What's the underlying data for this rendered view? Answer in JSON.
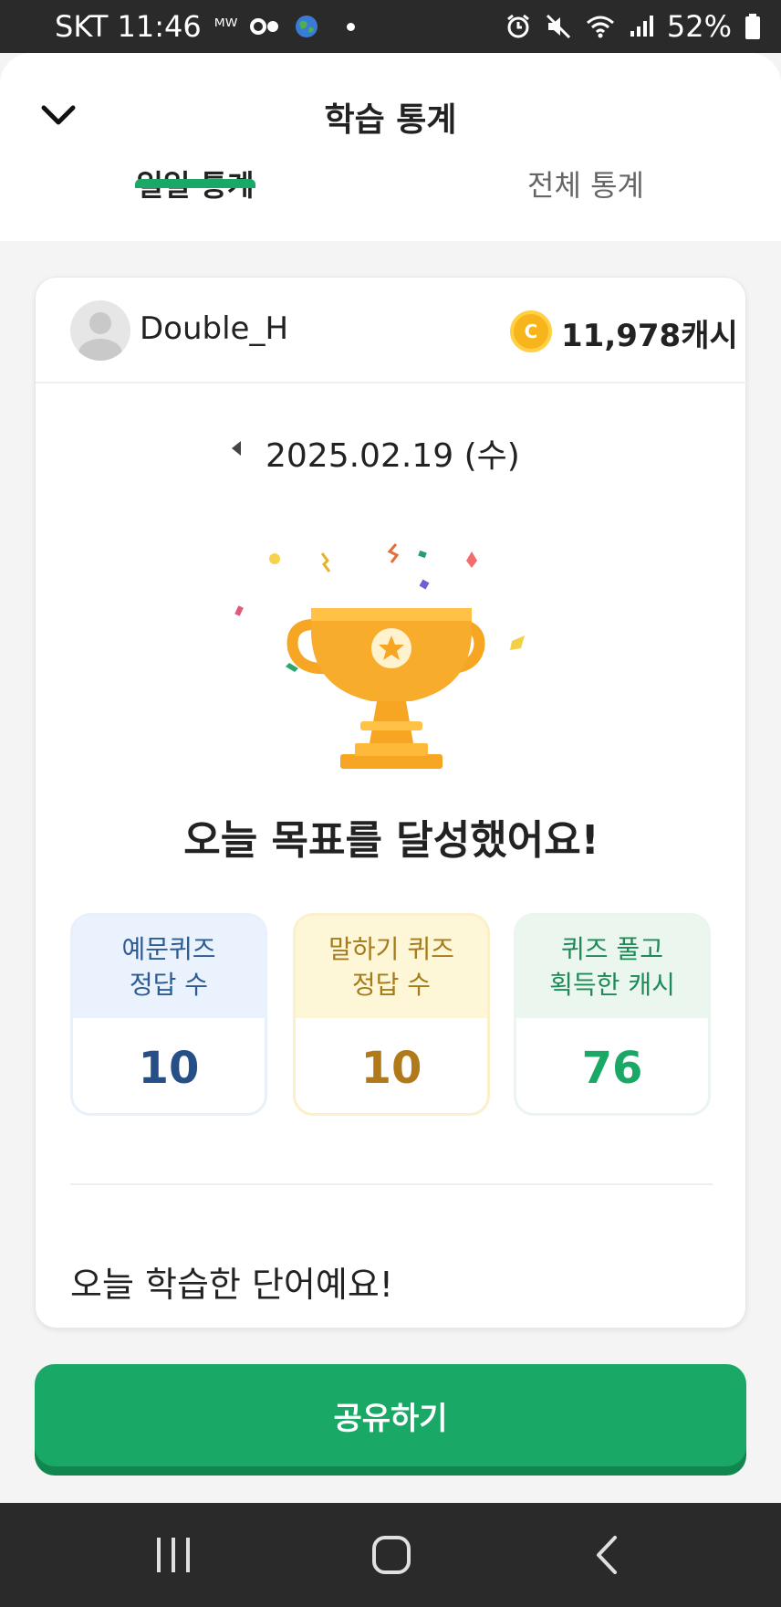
{
  "status_bar": {
    "carrier_time": "SKT 11:46",
    "mw_label": "ᴹᵂ",
    "battery": "52%",
    "icons": [
      "mw-icon",
      "dot-icon",
      "globe-icon",
      "alarm-icon",
      "mute-icon",
      "wifi-icon",
      "signal-icon",
      "battery-icon"
    ]
  },
  "header": {
    "title": "학습 통계",
    "close_icon": "chevron-down-icon"
  },
  "tabs": [
    {
      "label": "일일 통계",
      "active": true
    },
    {
      "label": "전체 통계",
      "active": false
    }
  ],
  "profile": {
    "username": "Double_H",
    "coin_symbol": "C",
    "cash": "11,978캐시"
  },
  "date_nav": {
    "date": "2025.02.19 (수)"
  },
  "goal": {
    "message": "오늘 목표를 달성했어요!"
  },
  "stats": [
    {
      "label_line1": "예문퀴즈",
      "label_line2": "정답 수",
      "value": "10",
      "color": "#264f87"
    },
    {
      "label_line1": "말하기 퀴즈",
      "label_line2": "정답 수",
      "value": "10",
      "color": "#b07a1a"
    },
    {
      "label_line1": "퀴즈 풀고",
      "label_line2": "획득한 캐시",
      "value": "76",
      "color": "#1aa866"
    }
  ],
  "words": {
    "title": "오늘 학습한 단어예요!"
  },
  "share_button": {
    "label": "공유하기"
  },
  "colors": {
    "accent": "#1aa866",
    "coin": "#f7b51b"
  }
}
